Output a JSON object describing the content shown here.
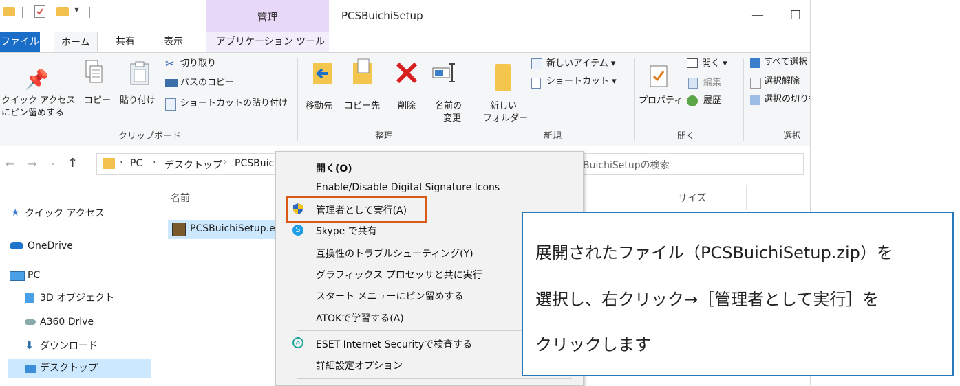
{
  "window": {
    "context_tab": "管理",
    "title": "PCSBuichiSetup",
    "minimize": "—",
    "maximize": "☐"
  },
  "tabs": [
    "ファイル",
    "ホーム",
    "共有",
    "表示",
    "アプリケーション ツール"
  ],
  "ribbon": {
    "clipboard": {
      "pin_line1": "クイック アクセス",
      "pin_line2": "にピン留めする",
      "copy": "コピー",
      "paste": "貼り付け",
      "cut": "切り取り",
      "copy_path": "パスのコピー",
      "paste_shortcut": "ショートカットの貼り付け",
      "group": "クリップボード"
    },
    "organize": {
      "move_to": "移動先",
      "copy_to": "コピー先",
      "delete": "削除",
      "rename_line1": "名前の",
      "rename_line2": "変更",
      "group": "整理"
    },
    "new": {
      "new_folder_line1": "新しい",
      "new_folder_line2": "フォルダー",
      "new_item": "新しいアイテム ▾",
      "shortcut": "ショートカット ▾",
      "group": "新規"
    },
    "open": {
      "properties": "プロパティ",
      "open": "開く ▾",
      "edit": "編集",
      "history": "履歴",
      "group": "開く"
    },
    "select": {
      "select_all": "すべて選択",
      "select_none": "選択解除",
      "invert": "選択の切り替え",
      "group": "選択"
    }
  },
  "address": {
    "path": [
      "PC",
      "デスクトップ",
      "PCSBuic"
    ],
    "search_placeholder": "BuichiSetupの検索"
  },
  "nav": {
    "quick_access": "クイック アクセス",
    "onedrive": "OneDrive",
    "pc": "PC",
    "objects3d": "3D オブジェクト",
    "a360": "A360 Drive",
    "downloads": "ダウンロード",
    "desktop": "デスクトップ"
  },
  "columns": {
    "name": "名前",
    "size": "サイズ"
  },
  "file": {
    "name": "PCSBuichiSetup.ex"
  },
  "context_menu": {
    "items": [
      "開く(O)",
      "Enable/Disable Digital Signature Icons",
      "管理者として実行(A)",
      "Skype で共有",
      "互換性のトラブルシューティング(Y)",
      "グラフィックス プロセッサと共に実行",
      "スタート メニューにピン留めする",
      "ATOKで学習する(A)",
      "ESET Internet Securityで検査する",
      "詳細設定オプション"
    ]
  },
  "callout": {
    "line1": "展開されたファイル（PCSBuichiSetup.zip）を",
    "line2": "選択し、右クリック→［管理者として実行］を",
    "line3": "クリックします"
  },
  "colors": {
    "file_tab": "#1a6ec8",
    "context_band": "#e8d8f7",
    "highlight_border": "#d85a17",
    "callout_border": "#2878b9",
    "delete_red": "#d92020"
  }
}
